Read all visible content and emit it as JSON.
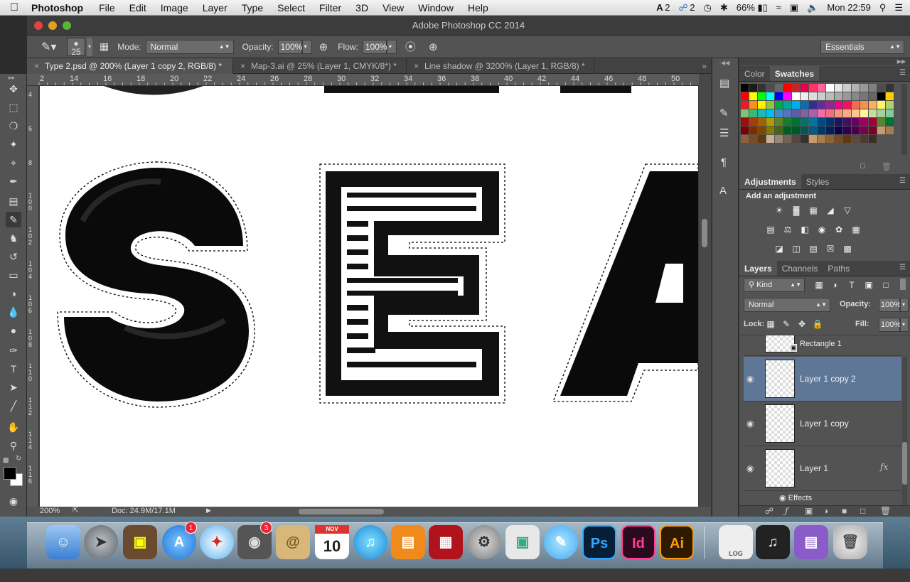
{
  "menubar": {
    "app_name": "Photoshop",
    "items": [
      "File",
      "Edit",
      "Image",
      "Layer",
      "Type",
      "Select",
      "Filter",
      "3D",
      "View",
      "Window",
      "Help"
    ],
    "status": {
      "adobe_count": "2",
      "cc_count": "2",
      "battery": "66%",
      "clock": "Mon 22:59"
    }
  },
  "window": {
    "title": "Adobe Photoshop CC 2014"
  },
  "options": {
    "brush_size": "25",
    "mode_label": "Mode:",
    "mode_value": "Normal",
    "opacity_label": "Opacity:",
    "opacity_value": "100%",
    "flow_label": "Flow:",
    "flow_value": "100%",
    "workspace": "Essentials"
  },
  "tabs": [
    {
      "label": "Type 2.psd @ 200% (Layer 1 copy 2, RGB/8) *",
      "active": true
    },
    {
      "label": "Map-3.ai @ 25% (Layer 1, CMYK/8*) *",
      "active": false
    },
    {
      "label": "Line shadow @ 3200% (Layer 1, RGB/8) *",
      "active": false
    }
  ],
  "ruler": {
    "h_ticks": [
      "2",
      "14",
      "16",
      "18",
      "20",
      "22",
      "24",
      "26",
      "28",
      "30",
      "32",
      "34",
      "36",
      "38",
      "40",
      "42",
      "44",
      "46",
      "48",
      "50"
    ],
    "v_ticks": [
      "4",
      "6",
      "8",
      "1 0 0",
      "1 0 2",
      "1 0 4",
      "1 0 6",
      "1 0 8",
      "1 1 0",
      "1 1 2",
      "1 1 4",
      "1 1 6"
    ]
  },
  "status": {
    "zoom": "200%",
    "doc": "Doc: 24.9M/17.1M"
  },
  "panels": {
    "color_tab": "Color",
    "swatches_tab": "Swatches",
    "adjustments_tab": "Adjustments",
    "styles_tab": "Styles",
    "add_adjustment": "Add an adjustment",
    "layers_tab": "Layers",
    "channels_tab": "Channels",
    "paths_tab": "Paths",
    "filter_kind": "Kind",
    "blend_mode": "Normal",
    "opacity_label": "Opacity:",
    "opacity_value": "100%",
    "lock_label": "Lock:",
    "fill_label": "Fill:",
    "fill_value": "100%",
    "layers": [
      {
        "name": "Layer 1 copy 2",
        "selected": true
      },
      {
        "name": "Layer 1 copy",
        "selected": false
      },
      {
        "name": "Layer 1",
        "selected": false,
        "fx": "fx"
      }
    ],
    "partial_layer": "Rectangle 1",
    "effects_label": "Effects"
  },
  "dock": {
    "badges": {
      "appstore": "1",
      "facetime": "3"
    },
    "calendar_month": "NOV",
    "calendar_day": "10",
    "apps": [
      "Ps",
      "Id",
      "Ai"
    ],
    "log_label": "LOG"
  },
  "colors": {
    "accent": "#6b86a8",
    "selected_layer": "#5f7796"
  }
}
